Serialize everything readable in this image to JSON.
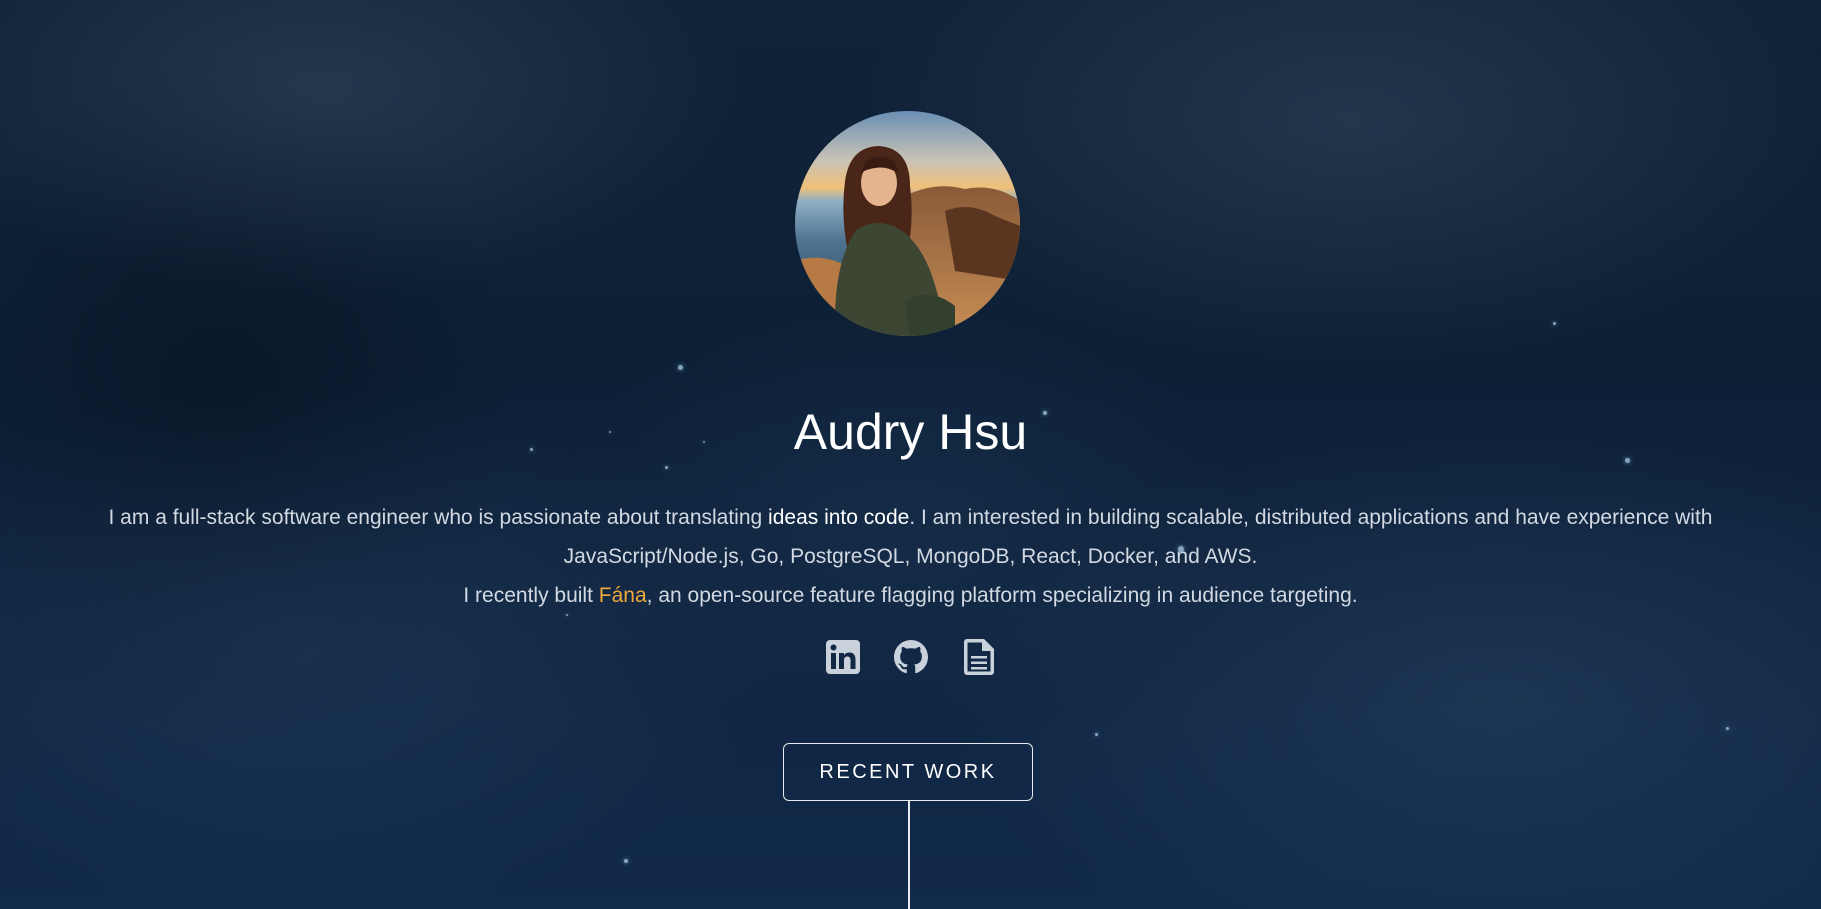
{
  "profile": {
    "name": "Audry Hsu",
    "avatar_alt": "Audry Hsu portrait"
  },
  "bio": {
    "line1_pre": "I am a full-stack software engineer who is passionate about translating ",
    "line1_highlight": "ideas into code",
    "line1_post": ". I am interested in building scalable, distributed applications and have experience with JavaScript/Node.js, Go, PostgreSQL, MongoDB, React, Docker, and AWS.",
    "line2_pre": "I recently built ",
    "project_link": "Fána",
    "line2_post": ", an open-source feature flagging platform specializing in audience targeting."
  },
  "social": [
    {
      "icon": "linkedin-icon",
      "label": "LinkedIn"
    },
    {
      "icon": "github-icon",
      "label": "GitHub"
    },
    {
      "icon": "resume-icon",
      "label": "Resume"
    }
  ],
  "cta": {
    "recent_work_label": "RECENT WORK"
  },
  "colors": {
    "background": "#0d2036",
    "accent": "#f0a83c",
    "text": "#d2d9e2",
    "heading": "#ffffff"
  }
}
